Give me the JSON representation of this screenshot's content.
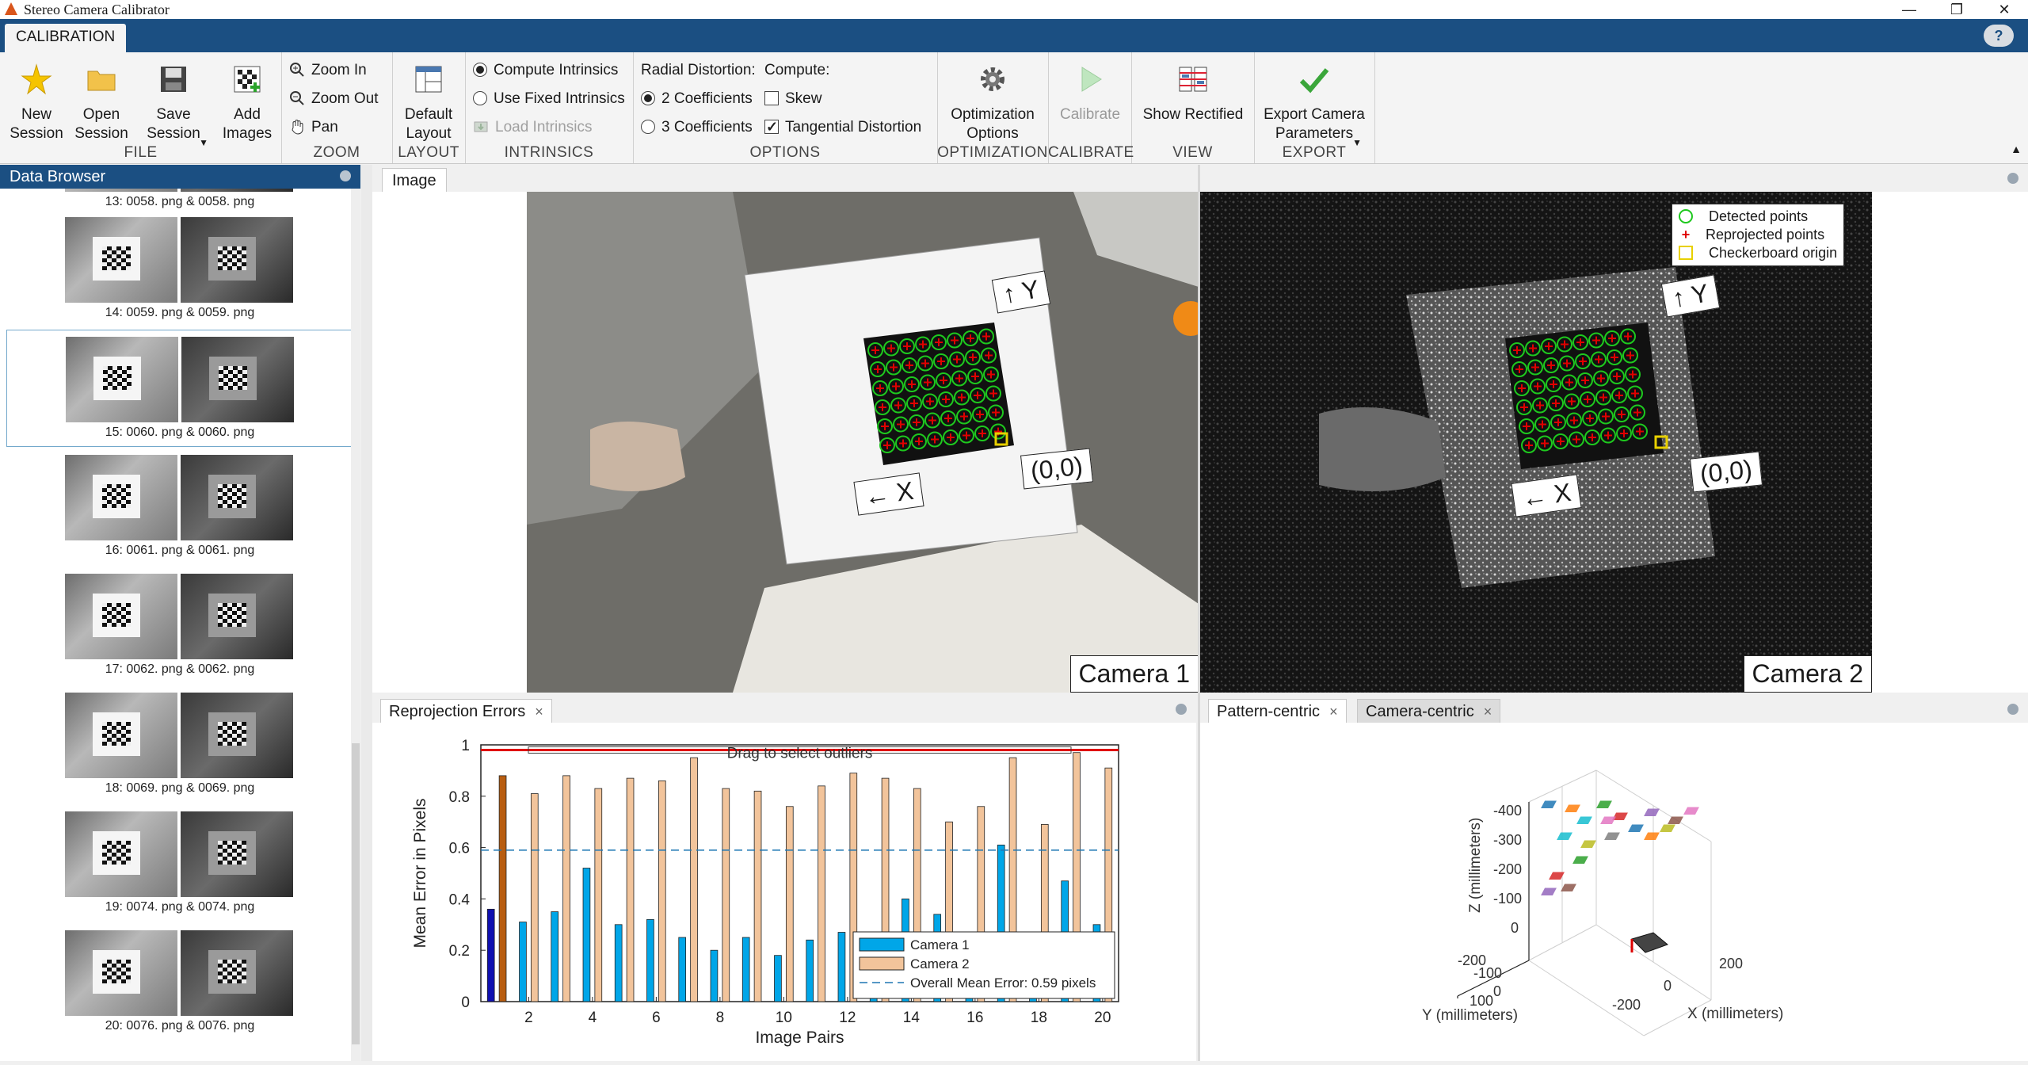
{
  "window": {
    "title": "Stereo Camera Calibrator"
  },
  "ribbon_tab": "CALIBRATION",
  "help_label": "?",
  "toolstrip": {
    "file": {
      "label": "FILE",
      "new_session": "New Session",
      "open_session": "Open Session",
      "save_session": "Save Session",
      "add_images": "Add Images"
    },
    "zoom": {
      "label": "ZOOM",
      "zoom_in": "Zoom In",
      "zoom_out": "Zoom Out",
      "pan": "Pan"
    },
    "layout": {
      "label": "LAYOUT",
      "default_layout": "Default Layout"
    },
    "intrinsics": {
      "label": "INTRINSICS",
      "compute": "Compute Intrinsics",
      "use_fixed": "Use Fixed Intrinsics",
      "load": "Load Intrinsics"
    },
    "options": {
      "label": "OPTIONS",
      "radial_title": "Radial Distortion:",
      "compute_title": "Compute:",
      "two_coef": "2 Coefficients",
      "three_coef": "3 Coefficients",
      "skew": "Skew",
      "tangential": "Tangential Distortion"
    },
    "optimization": {
      "label": "OPTIMIZATION",
      "options": "Optimization Options"
    },
    "calibrate": {
      "label": "CALIBRATE",
      "button": "Calibrate"
    },
    "view": {
      "label": "VIEW",
      "show_rectified": "Show Rectified"
    },
    "export": {
      "label": "EXPORT",
      "button": "Export Camera Parameters"
    }
  },
  "data_browser": {
    "title": "Data Browser",
    "items": [
      {
        "caption": "13:  0058. png  &  0058. png"
      },
      {
        "caption": "14:  0059. png  &  0059. png"
      },
      {
        "caption": "15:  0060. png  &  0060. png"
      },
      {
        "caption": "16:  0061. png  &  0061. png"
      },
      {
        "caption": "17:  0062. png  &  0062. png"
      },
      {
        "caption": "18:  0069. png  &  0069. png"
      },
      {
        "caption": "19:  0074. png  &  0074. png"
      },
      {
        "caption": "20:  0076. png  &  0076. png"
      }
    ],
    "selected_index": 2
  },
  "image_panel": {
    "tab": "Image",
    "camera1_label": "Camera 1",
    "camera2_label": "Camera 2",
    "y_arrow": "↑ Y",
    "x_arrow": "← X",
    "origin": "(0,0)",
    "legend": [
      "Detected points",
      "Reprojected points",
      "Checkerboard origin"
    ]
  },
  "reprojection_panel": {
    "tab": "Reprojection Errors",
    "close": "×"
  },
  "pattern_panel": {
    "tab_pattern": "Pattern-centric",
    "tab_camera": "Camera-centric",
    "close": "×",
    "zlabel": "Z (millimeters)",
    "ylabel": "Y (millimeters)",
    "xlabel": "X (millimeters)",
    "z_ticks": [
      "-400",
      "-300",
      "-200",
      "-100",
      "0",
      "-200"
    ],
    "y_ticks": [
      "-100",
      "0",
      "100"
    ],
    "x_ticks": [
      "-200",
      "0",
      "200"
    ]
  },
  "chart_data": {
    "type": "bar",
    "title": "Drag to select outliers",
    "xlabel": "Image Pairs",
    "ylabel": "Mean Error in Pixels",
    "ylim": [
      0,
      1
    ],
    "yticks": [
      0,
      0.2,
      0.4,
      0.6,
      0.8,
      1
    ],
    "xticks": [
      2,
      4,
      6,
      8,
      10,
      12,
      14,
      16,
      18,
      20
    ],
    "categories": [
      1,
      2,
      3,
      4,
      5,
      6,
      7,
      8,
      9,
      10,
      11,
      12,
      13,
      14,
      15,
      16,
      17,
      18,
      19,
      20
    ],
    "series": [
      {
        "name": "Camera 1",
        "color": "#00a6e8",
        "values": [
          0.36,
          0.31,
          0.35,
          0.52,
          0.3,
          0.32,
          0.25,
          0.2,
          0.25,
          0.18,
          0.24,
          0.27,
          0.26,
          0.4,
          0.34,
          0.2,
          0.61,
          0.26,
          0.47,
          0.3
        ]
      },
      {
        "name": "Camera 2",
        "color": "#f2c49b",
        "values": [
          0.88,
          0.81,
          0.88,
          0.83,
          0.87,
          0.86,
          0.95,
          0.83,
          0.82,
          0.76,
          0.84,
          0.89,
          0.87,
          0.83,
          0.7,
          0.76,
          0.95,
          0.69,
          0.97,
          0.91
        ]
      }
    ],
    "selected_pair": 1,
    "selected_colors": [
      "#1010b0",
      "#b85d10"
    ],
    "mean_line": {
      "name": "Overall Mean Error: 0.59 pixels",
      "value": 0.59,
      "color": "#1f77b4"
    },
    "threshold_line": {
      "value": 0.98,
      "color": "#e00000"
    },
    "legend_position": "bottom-right"
  }
}
